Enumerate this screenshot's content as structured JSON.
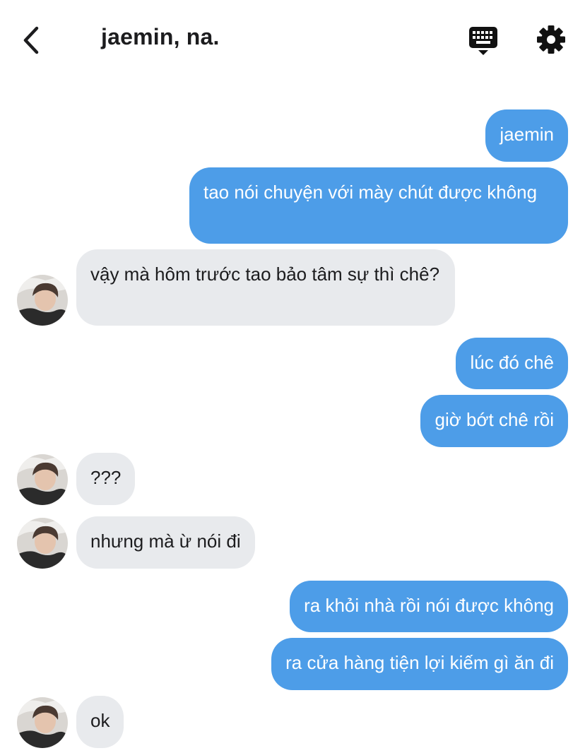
{
  "header": {
    "title": "jaemin, na.",
    "back_icon": "chevron-left-icon",
    "keyboard_icon": "keyboard-icon",
    "settings_icon": "gear-icon"
  },
  "colors": {
    "sent_bubble": "#4d9de8",
    "received_bubble": "#e8eaed"
  },
  "messages": [
    {
      "from": "me",
      "text": "jaemin"
    },
    {
      "from": "me",
      "text": "tao nói chuyện với mày chút được không"
    },
    {
      "from": "them",
      "text": "vậy mà hôm trước tao bảo tâm sự thì chê?"
    },
    {
      "from": "me",
      "text": "lúc đó chê"
    },
    {
      "from": "me",
      "text": "giờ bớt chê rồi"
    },
    {
      "from": "them",
      "text": "???"
    },
    {
      "from": "them",
      "text": "nhưng mà ừ nói đi"
    },
    {
      "from": "me",
      "text": "ra khỏi nhà rồi nói được không"
    },
    {
      "from": "me",
      "text": "ra cửa hàng tiện lợi kiếm gì ăn đi"
    },
    {
      "from": "them",
      "text": "ok"
    }
  ]
}
